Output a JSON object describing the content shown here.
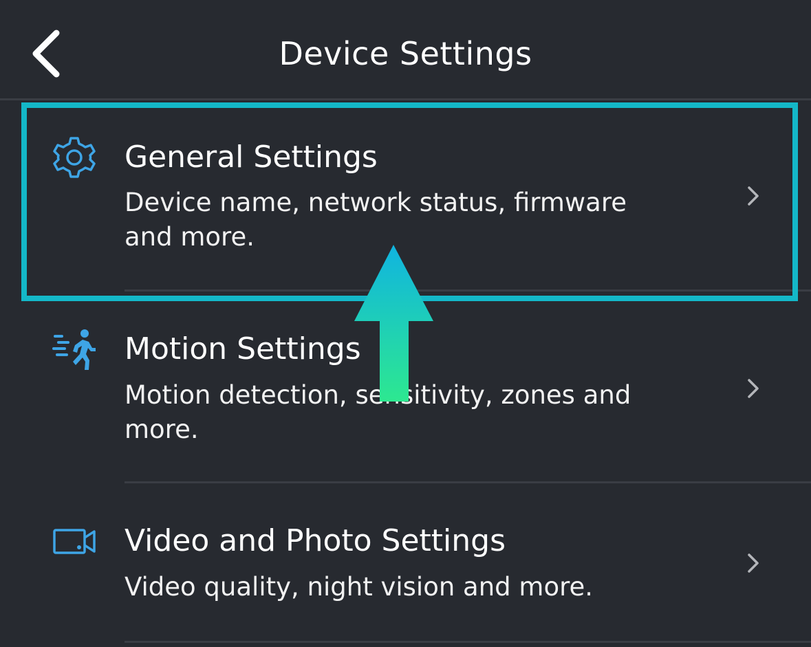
{
  "header": {
    "title": "Device Settings",
    "back_icon": "chevron-left-icon"
  },
  "rows": [
    {
      "icon": "gear-icon",
      "title": "General Settings",
      "subtitle": "Device name, network status, firmware and more."
    },
    {
      "icon": "running-person-icon",
      "title": "Motion Settings",
      "subtitle": "Motion detection, sensitivity, zones and more."
    },
    {
      "icon": "video-camera-icon",
      "title": "Video and Photo Settings",
      "subtitle": "Video quality, night vision and more."
    }
  ],
  "colors": {
    "background": "#272a30",
    "icon_accent": "#3ea5e6",
    "highlight": "#14b8c8",
    "arrow_top": "#10b4e0",
    "arrow_bottom": "#2de890"
  }
}
